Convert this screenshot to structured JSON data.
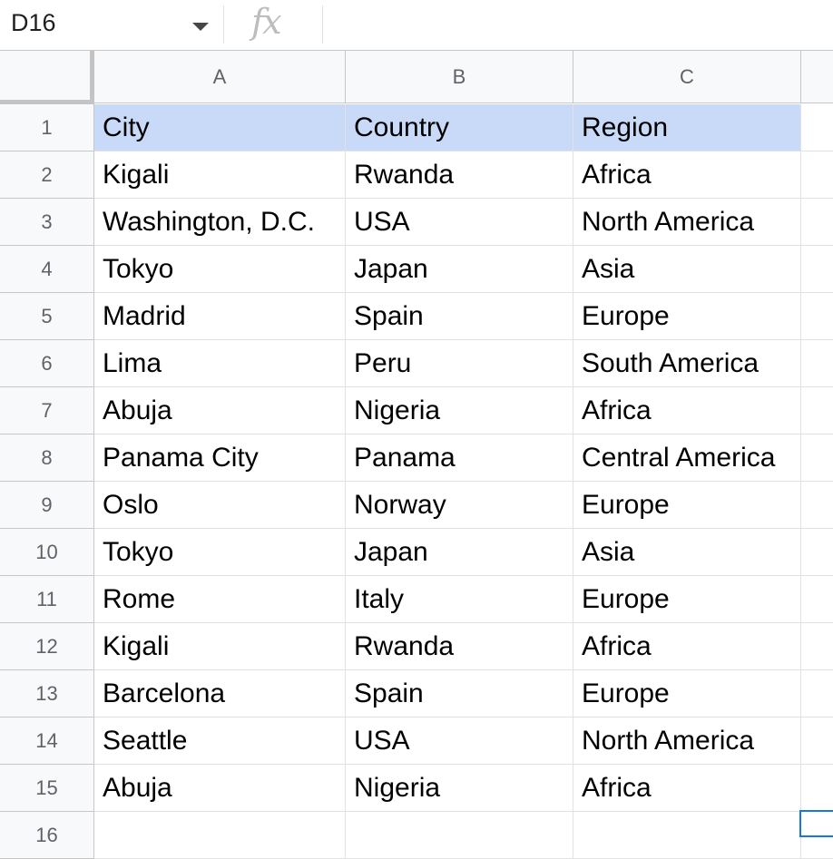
{
  "formula_bar": {
    "name_box": "D16",
    "fx_label": "fx",
    "formula": ""
  },
  "columns": [
    "A",
    "B",
    "C"
  ],
  "rows": [
    {
      "n": "1",
      "cells": [
        "City",
        "Country",
        "Region"
      ]
    },
    {
      "n": "2",
      "cells": [
        "Kigali",
        "Rwanda",
        "Africa"
      ]
    },
    {
      "n": "3",
      "cells": [
        "Washington, D.C.",
        "USA",
        "North America"
      ]
    },
    {
      "n": "4",
      "cells": [
        "Tokyo",
        "Japan",
        "Asia"
      ]
    },
    {
      "n": "5",
      "cells": [
        "Madrid",
        "Spain",
        "Europe"
      ]
    },
    {
      "n": "6",
      "cells": [
        "Lima",
        "Peru",
        "South America"
      ]
    },
    {
      "n": "7",
      "cells": [
        "Abuja",
        "Nigeria",
        "Africa"
      ]
    },
    {
      "n": "8",
      "cells": [
        "Panama City",
        "Panama",
        "Central America"
      ]
    },
    {
      "n": "9",
      "cells": [
        "Oslo",
        "Norway",
        "Europe"
      ]
    },
    {
      "n": "10",
      "cells": [
        "Tokyo",
        "Japan",
        "Asia"
      ]
    },
    {
      "n": "11",
      "cells": [
        "Rome",
        "Italy",
        "Europe"
      ]
    },
    {
      "n": "12",
      "cells": [
        "Kigali",
        "Rwanda",
        "Africa"
      ]
    },
    {
      "n": "13",
      "cells": [
        "Barcelona",
        "Spain",
        "Europe"
      ]
    },
    {
      "n": "14",
      "cells": [
        "Seattle",
        "USA",
        "North America"
      ]
    },
    {
      "n": "15",
      "cells": [
        "Abuja",
        "Nigeria",
        "Africa"
      ]
    },
    {
      "n": "16",
      "cells": [
        "",
        "",
        ""
      ]
    }
  ],
  "colors": {
    "header_row_fill": "#c9daf8",
    "selection_border": "#1a73e8"
  }
}
